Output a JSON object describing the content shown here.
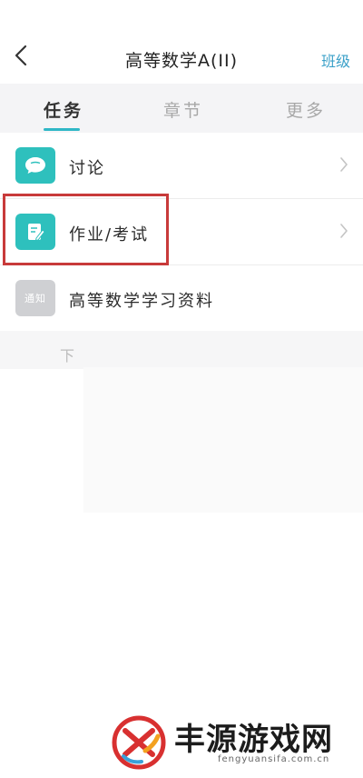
{
  "header": {
    "title": "高等数学A(II)",
    "right_link": "班级",
    "back_icon": "chevron-left-icon"
  },
  "tabs": [
    {
      "label": "任务",
      "active": true
    },
    {
      "label": "章节",
      "active": false
    },
    {
      "label": "更多",
      "active": false
    }
  ],
  "list": {
    "items": [
      {
        "label": "讨论",
        "icon": "chat-bubble-icon",
        "has_chevron": true
      },
      {
        "label": "作业/考试",
        "icon": "edit-note-icon",
        "has_chevron": true
      },
      {
        "label": "高等数学学习资料",
        "icon": "notice-icon",
        "icon_text": "通知",
        "has_chevron": false
      }
    ]
  },
  "hint": "下",
  "watermark": {
    "text": "丰源游戏网",
    "url": "fengyuansifa.com.cn"
  },
  "colors": {
    "accent": "#2fb7c6",
    "link": "#3aa0c8",
    "icon_teal": "#2ec0bd",
    "highlight_border": "#c83a3a"
  }
}
